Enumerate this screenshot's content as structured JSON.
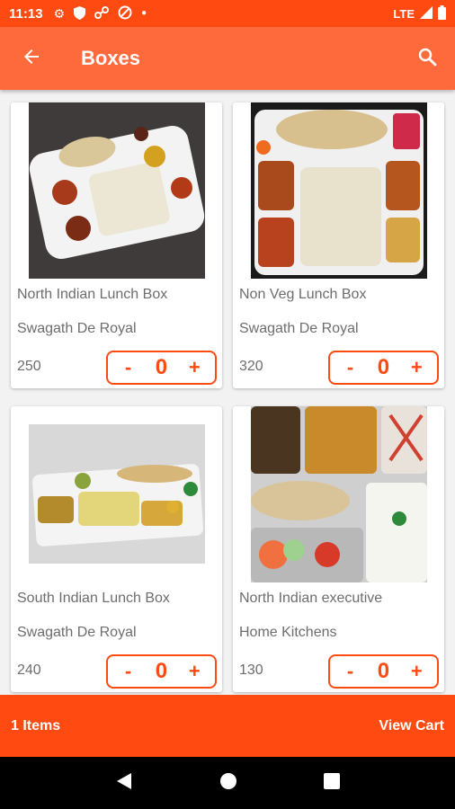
{
  "status_bar": {
    "time": "11:13",
    "network": "LTE",
    "icons": [
      "settings-icon",
      "shield-icon",
      "vpn-key-icon",
      "data-saver-icon",
      "dot-icon",
      "signal-icon",
      "battery-icon"
    ]
  },
  "app_bar": {
    "title": "Boxes",
    "back_icon": "arrow-back-icon",
    "search_icon": "search-icon"
  },
  "products": [
    {
      "name": "North Indian Lunch Box",
      "vendor": "Swagath De Royal",
      "price": "250",
      "qty": "0",
      "minus": "-",
      "plus": "+"
    },
    {
      "name": "Non Veg Lunch Box",
      "vendor": "Swagath De Royal",
      "price": "320",
      "qty": "0",
      "minus": "-",
      "plus": "+"
    },
    {
      "name": "South Indian Lunch Box",
      "vendor": "Swagath De Royal",
      "price": "240",
      "qty": "0",
      "minus": "-",
      "plus": "+"
    },
    {
      "name": "North Indian executive",
      "vendor": "Home Kitchens",
      "price": "130",
      "qty": "0",
      "minus": "-",
      "plus": "+"
    }
  ],
  "cart": {
    "items_label": "1 Items",
    "view_label": "View Cart"
  },
  "colors": {
    "accent": "#ff4a12",
    "app_bar": "#ff6a3d"
  }
}
